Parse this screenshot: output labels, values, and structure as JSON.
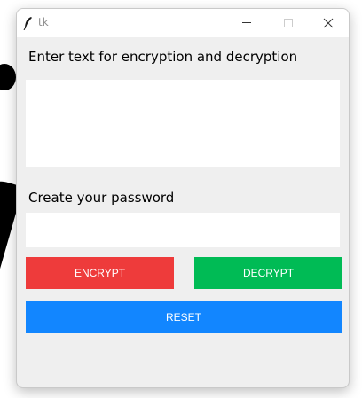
{
  "window": {
    "title": "tk",
    "controls": {
      "minimize_icon": "minimize-icon",
      "maximize_icon": "maximize-icon",
      "close_icon": "close-icon"
    }
  },
  "form": {
    "text_label": "Enter text for encryption and decryption",
    "text_value": "",
    "password_label": "Create your password",
    "password_value": ""
  },
  "buttons": {
    "encrypt_label": "ENCRYPT",
    "decrypt_label": "DECRYPT",
    "reset_label": "RESET"
  },
  "colors": {
    "encrypt": "#ee3b3b",
    "decrypt": "#00bb55",
    "reset": "#1286ff",
    "window_bg": "#efefef"
  }
}
